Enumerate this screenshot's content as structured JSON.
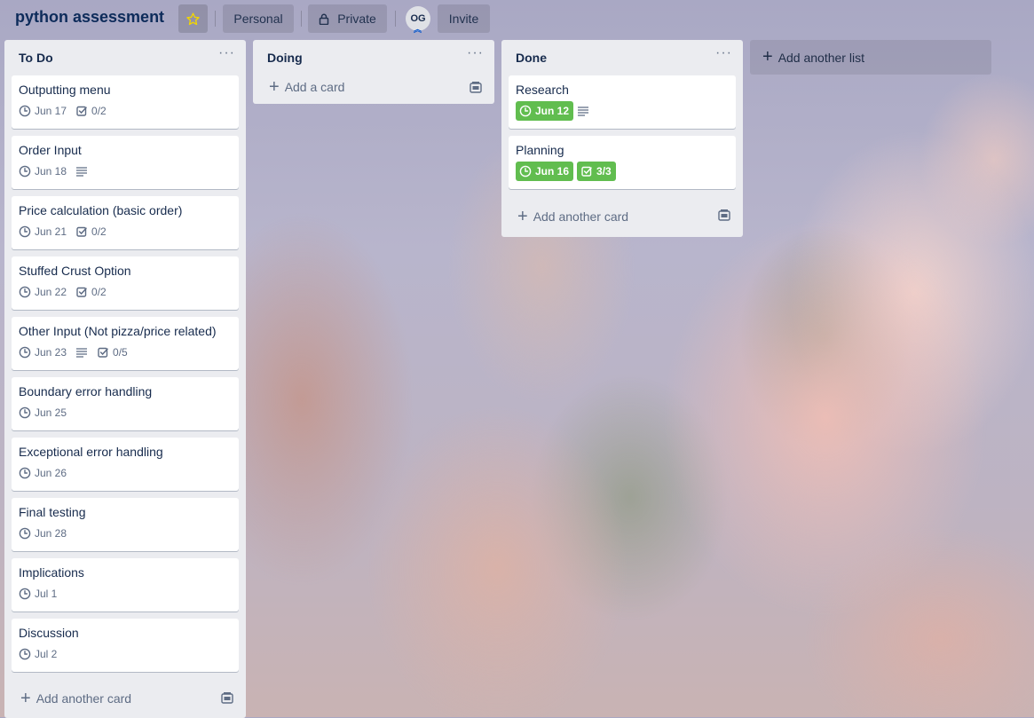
{
  "header": {
    "board_title": "python assessment",
    "team_label": "Personal",
    "visibility_label": "Private",
    "member_initials": "OG",
    "invite_label": "Invite"
  },
  "lists": [
    {
      "title": "To Do",
      "menu": "···",
      "cards": [
        {
          "title": "Outputting menu",
          "due": "Jun 17",
          "checklist": "0/2"
        },
        {
          "title": "Order Input",
          "due": "Jun 18",
          "description": true
        },
        {
          "title": "Price calculation (basic order)",
          "due": "Jun 21",
          "checklist": "0/2"
        },
        {
          "title": "Stuffed Crust Option",
          "due": "Jun 22",
          "checklist": "0/2"
        },
        {
          "title": "Other Input (Not pizza/price related)",
          "due": "Jun 23",
          "description": true,
          "checklist": "0/5"
        },
        {
          "title": "Boundary error handling",
          "due": "Jun 25"
        },
        {
          "title": "Exceptional error handling",
          "due": "Jun 26"
        },
        {
          "title": "Final testing",
          "due": "Jun 28"
        },
        {
          "title": "Implications",
          "due": "Jul 1"
        },
        {
          "title": "Discussion",
          "due": "Jul 2"
        }
      ],
      "add_label": "Add another card"
    },
    {
      "title": "Doing",
      "menu": "···",
      "cards": [],
      "add_label": "Add a card"
    },
    {
      "title": "Done",
      "menu": "···",
      "cards": [
        {
          "title": "Research",
          "due": "Jun 12",
          "due_complete": true,
          "description": true
        },
        {
          "title": "Planning",
          "due": "Jun 16",
          "due_complete": true,
          "checklist": "3/3",
          "checklist_complete": true
        }
      ],
      "add_label": "Add another card"
    }
  ],
  "add_list_label": "Add another list",
  "colors": {
    "complete_green": "#61bd4f",
    "list_bg": "#ebecf0",
    "text": "#172b4d",
    "muted": "#5e6c84"
  }
}
